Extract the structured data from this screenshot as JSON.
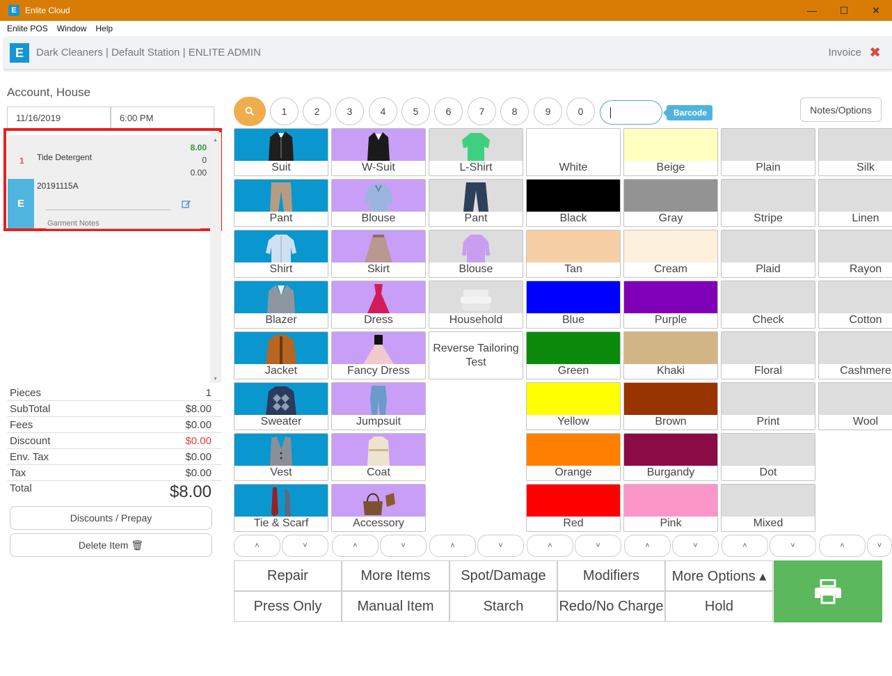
{
  "window": {
    "title": "Enlite Cloud",
    "minimize": "—",
    "maximize": "☐",
    "close": "✕"
  },
  "menu": [
    "Enlite POS",
    "Window",
    "Help"
  ],
  "header": {
    "title": "Dark Cleaners | Default Station | ENLITE ADMIN",
    "invoice": "Invoice",
    "close": "✖",
    "logo": "E"
  },
  "order": {
    "account": "Account, House",
    "date": "11/16/2019",
    "time": "6:00 PM",
    "item": {
      "qty": "1",
      "name": "Tide Detergent",
      "price": "8.00",
      "line2": "0",
      "line3": "0.00",
      "badge": "E",
      "tag": "20191115A",
      "notes_label": "Garment Notes"
    }
  },
  "totals": [
    {
      "label": "Pieces",
      "value": "1"
    },
    {
      "label": "SubTotal",
      "value": "$8.00"
    },
    {
      "label": "Fees",
      "value": "$0.00"
    },
    {
      "label": "Discount",
      "value": "$0.00"
    },
    {
      "label": "Env. Tax",
      "value": "$0.00"
    },
    {
      "label": "Tax",
      "value": "$0.00"
    }
  ],
  "total": {
    "label": "Total",
    "value": "$8.00"
  },
  "left_buttons": {
    "discounts": "Discounts / Prepay",
    "delete": "Delete Item 🗑"
  },
  "numpad": [
    "1",
    "2",
    "3",
    "4",
    "5",
    "6",
    "7",
    "8",
    "9",
    "0"
  ],
  "barcode": {
    "value": "",
    "badge": "Barcode"
  },
  "notes_options": "Notes/Options",
  "columns": [
    {
      "items": [
        {
          "label": "Suit",
          "bg": "#0a97cf",
          "icon": "suit"
        },
        {
          "label": "Pant",
          "bg": "#0a97cf",
          "icon": "pant"
        },
        {
          "label": "Shirt",
          "bg": "#0a97cf",
          "icon": "shirt"
        },
        {
          "label": "Blazer",
          "bg": "#0a97cf",
          "icon": "blazer"
        },
        {
          "label": "Jacket",
          "bg": "#0a97cf",
          "icon": "jacket"
        },
        {
          "label": "Sweater",
          "bg": "#0a97cf",
          "icon": "sweater"
        },
        {
          "label": "Vest",
          "bg": "#0a97cf",
          "icon": "vest"
        },
        {
          "label": "Tie & Scarf",
          "bg": "#0a97cf",
          "icon": "tie"
        }
      ]
    },
    {
      "items": [
        {
          "label": "W-Suit",
          "bg": "#c99ef6",
          "icon": "wsuit"
        },
        {
          "label": "Blouse",
          "bg": "#c99ef6",
          "icon": "blouse"
        },
        {
          "label": "Skirt",
          "bg": "#c99ef6",
          "icon": "skirt"
        },
        {
          "label": "Dress",
          "bg": "#c99ef6",
          "icon": "dress"
        },
        {
          "label": "Fancy Dress",
          "bg": "#c99ef6",
          "icon": "fancydress"
        },
        {
          "label": "Jumpsuit",
          "bg": "#c99ef6",
          "icon": "jumpsuit"
        },
        {
          "label": "Coat",
          "bg": "#c99ef6",
          "icon": "coat"
        },
        {
          "label": "Accessory",
          "bg": "#c99ef6",
          "icon": "accessory"
        }
      ]
    },
    {
      "items": [
        {
          "label": "L-Shirt",
          "bg": "#dddddd",
          "icon": "lshirt"
        },
        {
          "label": "Pant",
          "bg": "#dddddd",
          "icon": "jeans"
        },
        {
          "label": "Blouse",
          "bg": "#dddddd",
          "icon": "lblouse"
        },
        {
          "label": "Household",
          "bg": "#dddddd",
          "icon": "household"
        },
        {
          "label": "Reverse Tailoring Test",
          "bg": "#dddddd",
          "icon": "none"
        }
      ]
    },
    {
      "items": [
        {
          "label": "White",
          "bg": "#ffffff"
        },
        {
          "label": "Black",
          "bg": "#000000"
        },
        {
          "label": "Tan",
          "bg": "#f6cfa6"
        },
        {
          "label": "Blue",
          "bg": "#0000ff"
        },
        {
          "label": "Green",
          "bg": "#0b8a0b"
        },
        {
          "label": "Yellow",
          "bg": "#ffff00"
        },
        {
          "label": "Orange",
          "bg": "#ff8000"
        },
        {
          "label": "Red",
          "bg": "#ff0000"
        }
      ]
    },
    {
      "items": [
        {
          "label": "Beige",
          "bg": "#ffffc0"
        },
        {
          "label": "Gray",
          "bg": "#939393"
        },
        {
          "label": "Cream",
          "bg": "#fdf0dc"
        },
        {
          "label": "Purple",
          "bg": "#8000b8"
        },
        {
          "label": "Khaki",
          "bg": "#d2b584"
        },
        {
          "label": "Brown",
          "bg": "#993300"
        },
        {
          "label": "Burgandy",
          "bg": "#8b0b44"
        },
        {
          "label": "Pink",
          "bg": "#fd96c8"
        }
      ]
    },
    {
      "items": [
        {
          "label": "Plain",
          "bg": "#dddddd"
        },
        {
          "label": "Stripe",
          "bg": "#dddddd"
        },
        {
          "label": "Plaid",
          "bg": "#dddddd"
        },
        {
          "label": "Check",
          "bg": "#dddddd"
        },
        {
          "label": "Floral",
          "bg": "#dddddd"
        },
        {
          "label": "Print",
          "bg": "#dddddd"
        },
        {
          "label": "Dot",
          "bg": "#dddddd"
        },
        {
          "label": "Mixed",
          "bg": "#dddddd"
        }
      ]
    },
    {
      "items": [
        {
          "label": "Silk",
          "bg": "#dddddd"
        },
        {
          "label": "Linen",
          "bg": "#dddddd"
        },
        {
          "label": "Rayon",
          "bg": "#dddddd"
        },
        {
          "label": "Cotton",
          "bg": "#dddddd"
        },
        {
          "label": "Cashmere",
          "bg": "#dddddd"
        },
        {
          "label": "Wool",
          "bg": "#dddddd"
        }
      ]
    }
  ],
  "arrows": {
    "up": "˄",
    "down": "˅"
  },
  "actions": {
    "row1": [
      "Repair",
      "More Items",
      "Spot/Damage",
      "Modifiers",
      "More Options ▴"
    ],
    "row2": [
      "Press Only",
      "Manual Item",
      "Starch",
      "Redo/No Charge",
      "Hold"
    ]
  },
  "colors": {
    "accent": "#d97c06",
    "brand": "#1496d6",
    "print": "#5cb85c",
    "highlight": "#ee1c1c"
  }
}
